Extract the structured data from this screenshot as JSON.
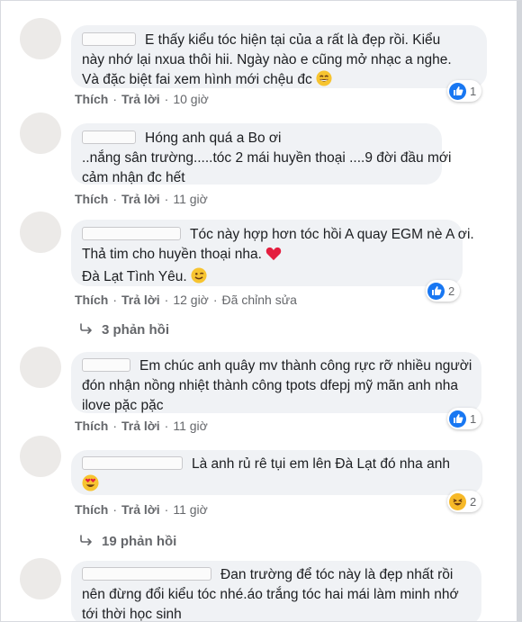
{
  "colors": {
    "bubble": "#f0f2f5",
    "like_blue": "#1877f2",
    "meta_gray": "#65676b",
    "haha_yellow": "#f7b928",
    "heart_red": "#e41e3f"
  },
  "comments": [
    {
      "lines": [
        "E thấy kiểu tóc hiện tại của a rất là đẹp rồi. Kiểu",
        "này nhớ lại nxua thôi hii. Ngày nào e cũng mở nhạc a nghe.",
        "Và đặc biệt fai xem hình mới chệu đc"
      ],
      "like_label": "Thích",
      "reply_label": "Trả lời",
      "time": "10 giờ",
      "reaction_count": "1"
    },
    {
      "lines": [
        "Hóng anh quá a Bo ơi",
        "..nắng sân trường.....tóc 2 mái huyền thoại ....9 đời đầu mới",
        "cảm nhận đc hết"
      ],
      "like_label": "Thích",
      "reply_label": "Trả lời",
      "time": "11 giờ"
    },
    {
      "lines": [
        "Tóc này hợp hơn tóc hồi A quay EGM nè A ơi.",
        "Thả tim cho huyền thoại nha.",
        "Đà Lạt Tình Yêu."
      ],
      "like_label": "Thích",
      "reply_label": "Trả lời",
      "time": "12 giờ",
      "edited": "Đã chỉnh sửa",
      "reaction_count": "2",
      "replies": "3 phản hồi"
    },
    {
      "lines": [
        "Em chúc anh quây mv thành công rực rỡ nhiều người",
        "đón nhận nồng nhiệt thành công tpots dfepj mỹ mãn anh nha",
        "ilove pặc pặc"
      ],
      "like_label": "Thích",
      "reply_label": "Trả lời",
      "time": "11 giờ",
      "reaction_count": "1"
    },
    {
      "lines": [
        "Là anh rủ rê tụi em lên Đà Lạt đó nha anh"
      ],
      "like_label": "Thích",
      "reply_label": "Trả lời",
      "time": "11 giờ",
      "reaction_count": "2",
      "replies": "19 phản hồi"
    },
    {
      "lines": [
        "Đan trường để tóc này là đẹp nhất rồi",
        "nên đừng đổi kiểu tóc nhé.áo trắng tóc hai mái làm minh nhớ",
        "tới thời học sinh"
      ]
    }
  ]
}
